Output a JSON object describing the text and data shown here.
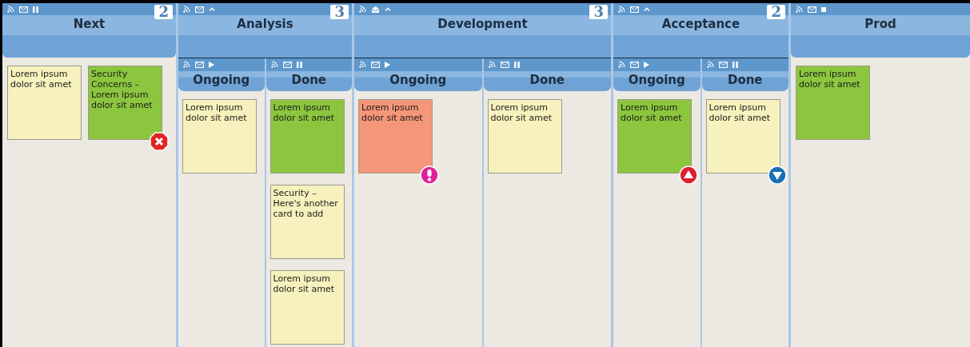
{
  "columns": [
    {
      "title": "Next",
      "count": "2",
      "control": {
        "kind": "pause"
      },
      "mail_open": false,
      "cards": [
        {
          "text": "Lorem ipsum dolor sit amet",
          "color": "#f7f1bd"
        },
        {
          "text": "Security Concerns – Lorem ipsum dolor sit amet",
          "color": "#8cc63f",
          "badge": {
            "kind": "error"
          }
        }
      ]
    },
    {
      "title": "Analysis",
      "count": "3",
      "control": {
        "kind": "up"
      },
      "mail_open": false,
      "lanes": [
        {
          "title": "Ongoing",
          "control": {
            "kind": "play"
          },
          "mail_open": false,
          "cards": [
            {
              "text": "Lorem ipsum dolor sit amet",
              "color": "#f7f1bd"
            }
          ]
        },
        {
          "title": "Done",
          "control": {
            "kind": "pause"
          },
          "mail_open": false,
          "cards": [
            {
              "text": "Lorem ipsum dolor sit amet",
              "color": "#8cc63f"
            },
            {
              "text": "Security – Here's another card to add",
              "color": "#f7f1bd"
            },
            {
              "text": "Lorem ipsum dolor sit amet",
              "color": "#f7f1bd"
            }
          ]
        }
      ]
    },
    {
      "title": "Development",
      "count": "3",
      "control": {
        "kind": "up"
      },
      "mail_open": true,
      "lanes": [
        {
          "title": "Ongoing",
          "control": {
            "kind": "play"
          },
          "mail_open": false,
          "cards": [
            {
              "text": "Lorem ipsum dolor sit amet",
              "color": "#f5967a",
              "badge": {
                "kind": "alert"
              }
            }
          ]
        },
        {
          "title": "Done",
          "control": {
            "kind": "pause"
          },
          "mail_open": false,
          "cards": [
            {
              "text": "Lorem ipsum dolor sit amet",
              "color": "#f7f1bd"
            }
          ]
        }
      ]
    },
    {
      "title": "Acceptance",
      "count": "2",
      "control": {
        "kind": "up"
      },
      "mail_open": false,
      "lanes": [
        {
          "title": "Ongoing",
          "control": {
            "kind": "play"
          },
          "mail_open": false,
          "cards": [
            {
              "text": "Lorem ipsum dolor sit amet",
              "color": "#8cc63f",
              "badge": {
                "kind": "up"
              }
            }
          ]
        },
        {
          "title": "Done",
          "control": {
            "kind": "pause"
          },
          "mail_open": false,
          "cards": [
            {
              "text": "Lorem ipsum dolor sit amet",
              "color": "#f7f1bd",
              "badge": {
                "kind": "down"
              }
            }
          ]
        }
      ]
    },
    {
      "title": "Prod",
      "control": {
        "kind": "stop"
      },
      "mail_open": false,
      "cards": [
        {
          "text": "Lorem ipsum dolor sit amet",
          "color": "#8cc63f"
        }
      ]
    }
  ]
}
